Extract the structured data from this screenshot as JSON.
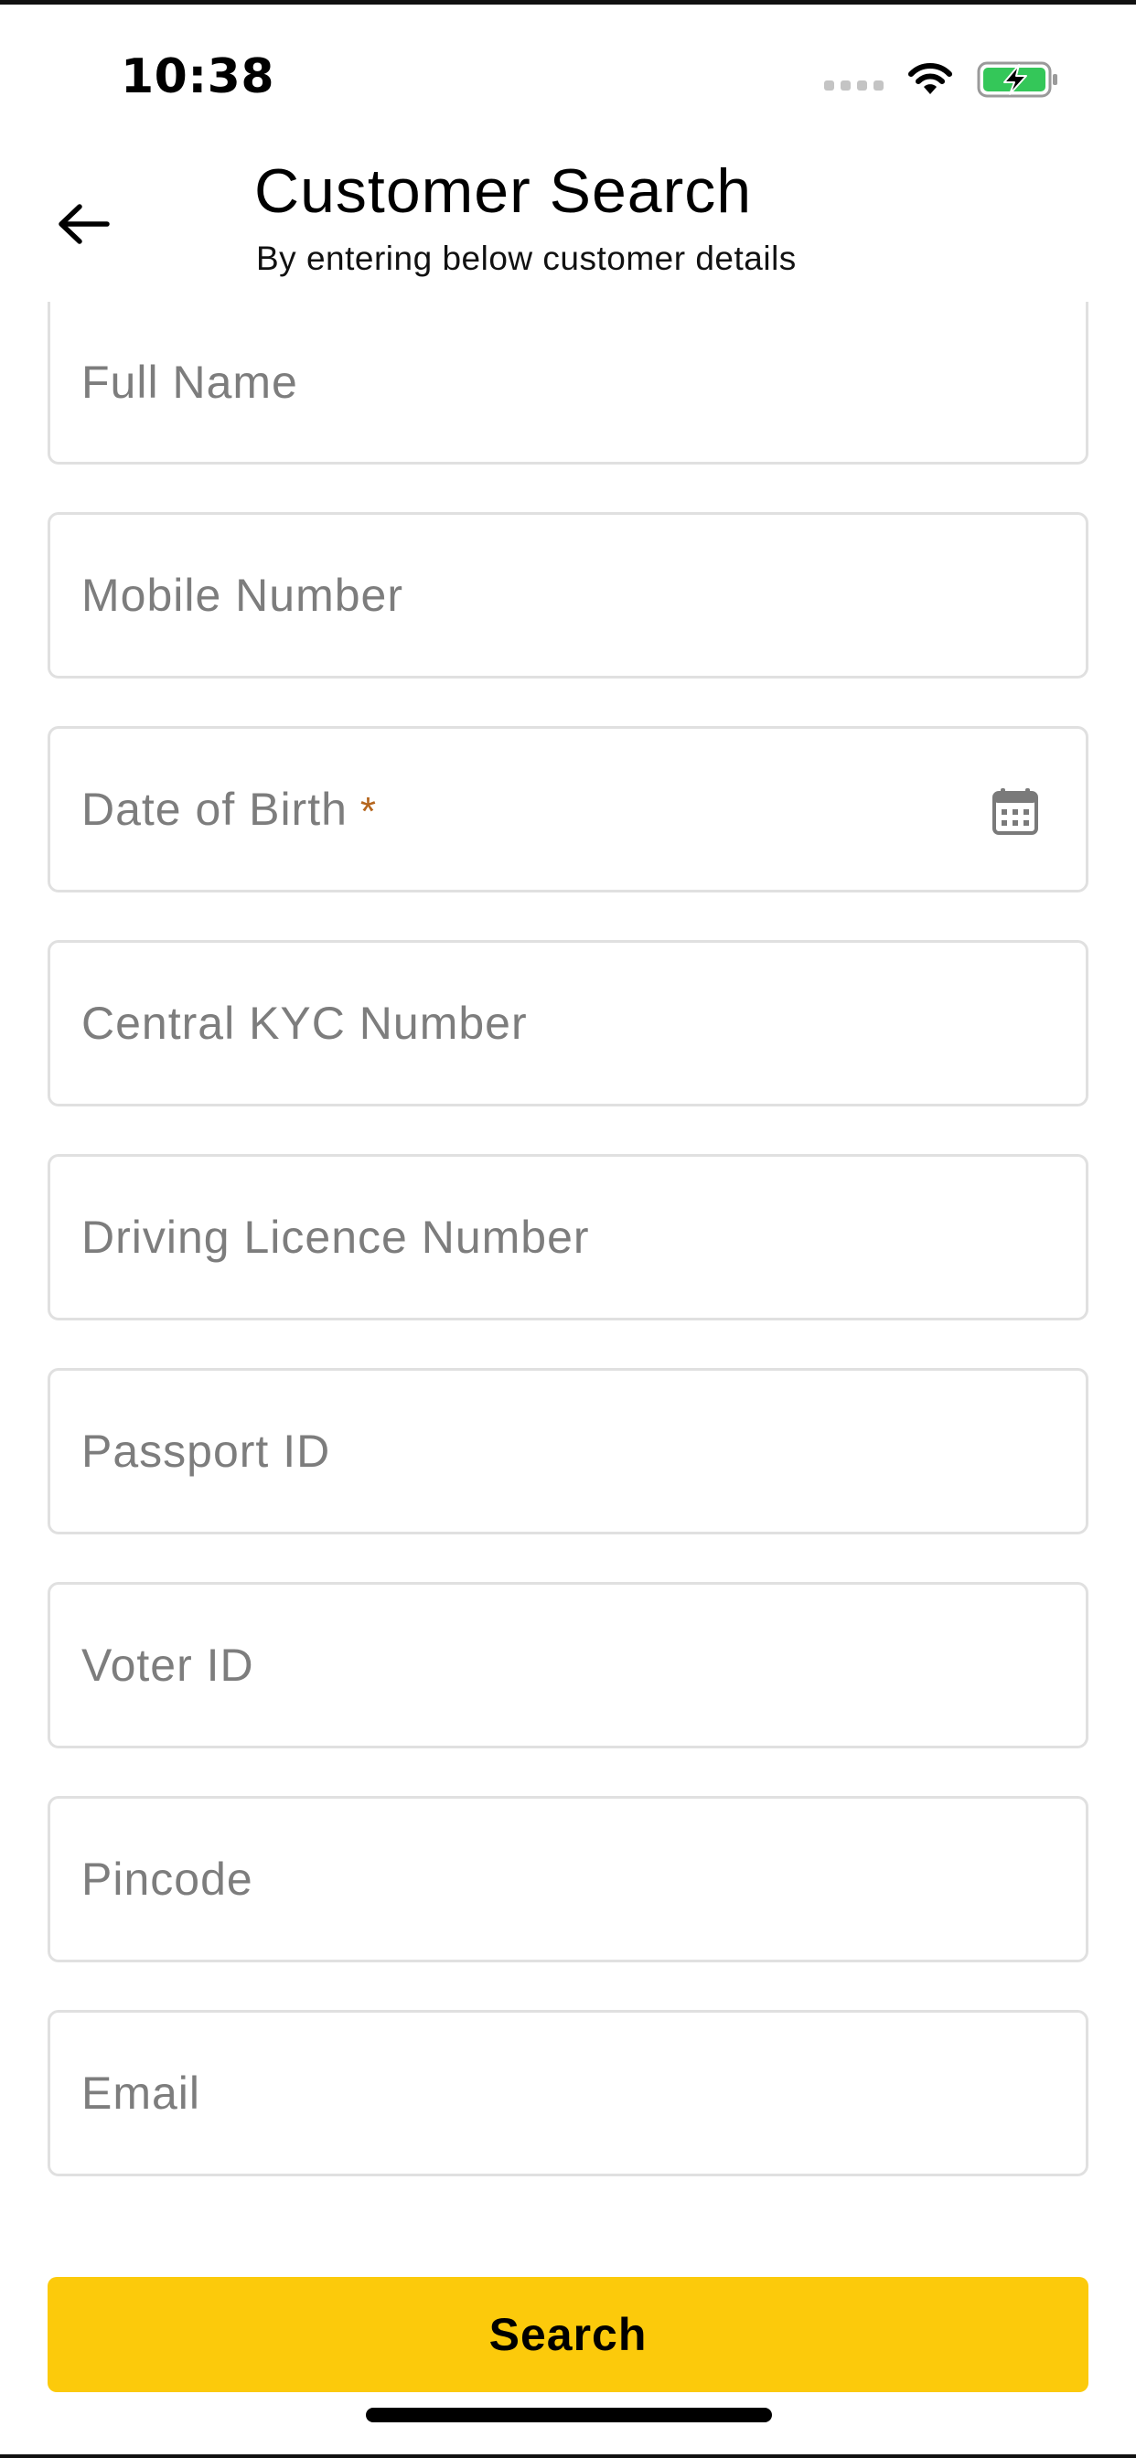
{
  "status_bar": {
    "time": "10:38"
  },
  "header": {
    "title": "Customer Search",
    "subtitle": "By entering below customer details"
  },
  "form": {
    "full_name": {
      "placeholder": "Full Name"
    },
    "mobile_number": {
      "placeholder": "Mobile Number"
    },
    "date_of_birth": {
      "label": "Date of Birth",
      "required_marker": "*"
    },
    "central_kyc_number": {
      "placeholder": "Central KYC Number"
    },
    "driving_licence_number": {
      "placeholder": "Driving Licence Number"
    },
    "passport_id": {
      "placeholder": "Passport ID"
    },
    "voter_id": {
      "placeholder": "Voter ID"
    },
    "pincode": {
      "placeholder": "Pincode"
    },
    "email": {
      "placeholder": "Email"
    }
  },
  "actions": {
    "search_label": "Search"
  },
  "colors": {
    "accent": "#fcca0b",
    "required": "#b5651d",
    "placeholder": "#7d7d7d",
    "field_border": "#e0e0e0",
    "battery_fill": "#34c759"
  },
  "icons": {
    "back": "arrow-left-icon",
    "calendar": "calendar-icon",
    "wifi": "wifi-icon",
    "battery": "battery-charging-icon",
    "signal": "cellular-signal-icon"
  }
}
